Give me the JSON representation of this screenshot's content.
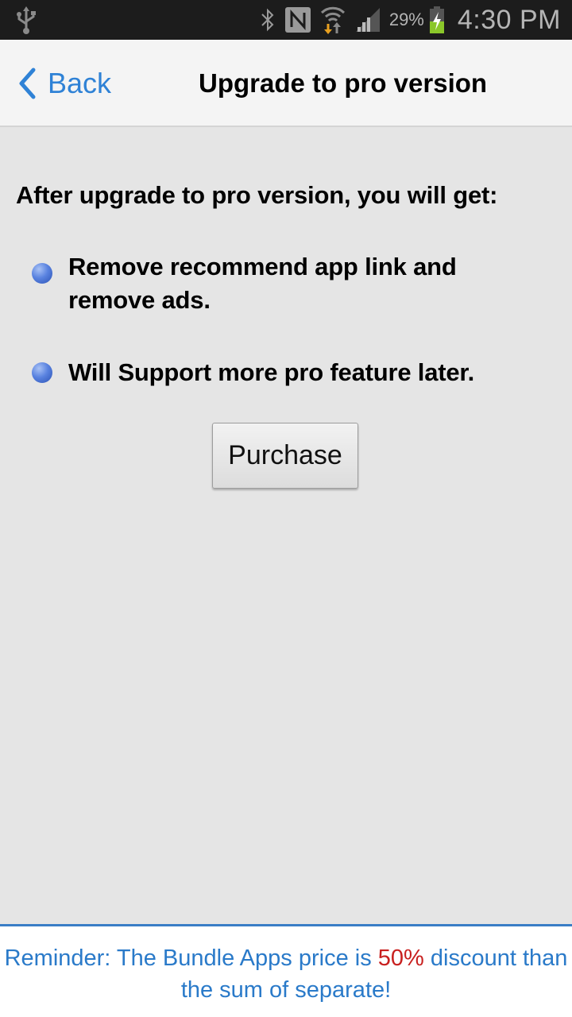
{
  "status_bar": {
    "icons": [
      "usb-icon",
      "bluetooth-icon",
      "nfc-icon",
      "wifi-icon",
      "signal-icon",
      "battery-charging-icon"
    ],
    "battery_percent": "29%",
    "time": "4:30 PM"
  },
  "header": {
    "back_label": "Back",
    "title": "Upgrade to pro version"
  },
  "content": {
    "intro": "After upgrade to pro version, you will get:",
    "features": [
      {
        "text": "Remove recommend app link and remove ads."
      },
      {
        "text": "Will Support more pro feature later."
      }
    ],
    "purchase_label": "Purchase"
  },
  "footer": {
    "text_before": "Reminder: The Bundle Apps price is ",
    "highlight": "50%",
    "text_after": " discount than the sum of separate!",
    "colors": {
      "text": "#2a7ac9",
      "highlight": "#c8201f"
    }
  }
}
